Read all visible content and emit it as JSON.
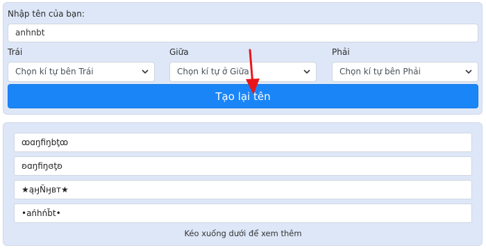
{
  "form": {
    "name_label": "Nhập tên của bạn:",
    "name_value": "anhnbt",
    "left_label": "Trái",
    "middle_label": "Giữa",
    "right_label": "Phải",
    "left_select": "Chọn kí tự bên Trái",
    "middle_select": "Chọn kí tự ở Giữa",
    "right_select": "Chọn kí tự bên Phải",
    "submit_label": "Tạo lại tên"
  },
  "results": [
    "ꝏɑŋfiŋbƫꝏ",
    "ʚɑŋfiŋɞƫʚ",
    "★ąӈÑӈвт★",
    "•ańhńb̃t•"
  ],
  "hint": "Kéo xuống dưới để xem thêm",
  "colors": {
    "panel_bg": "#dde7f7",
    "button_bg": "#1a85f7",
    "arrow": "#e8161b"
  },
  "icons": {
    "select_chevron": "chevron-down-icon",
    "annotation": "red-arrow-icon"
  }
}
